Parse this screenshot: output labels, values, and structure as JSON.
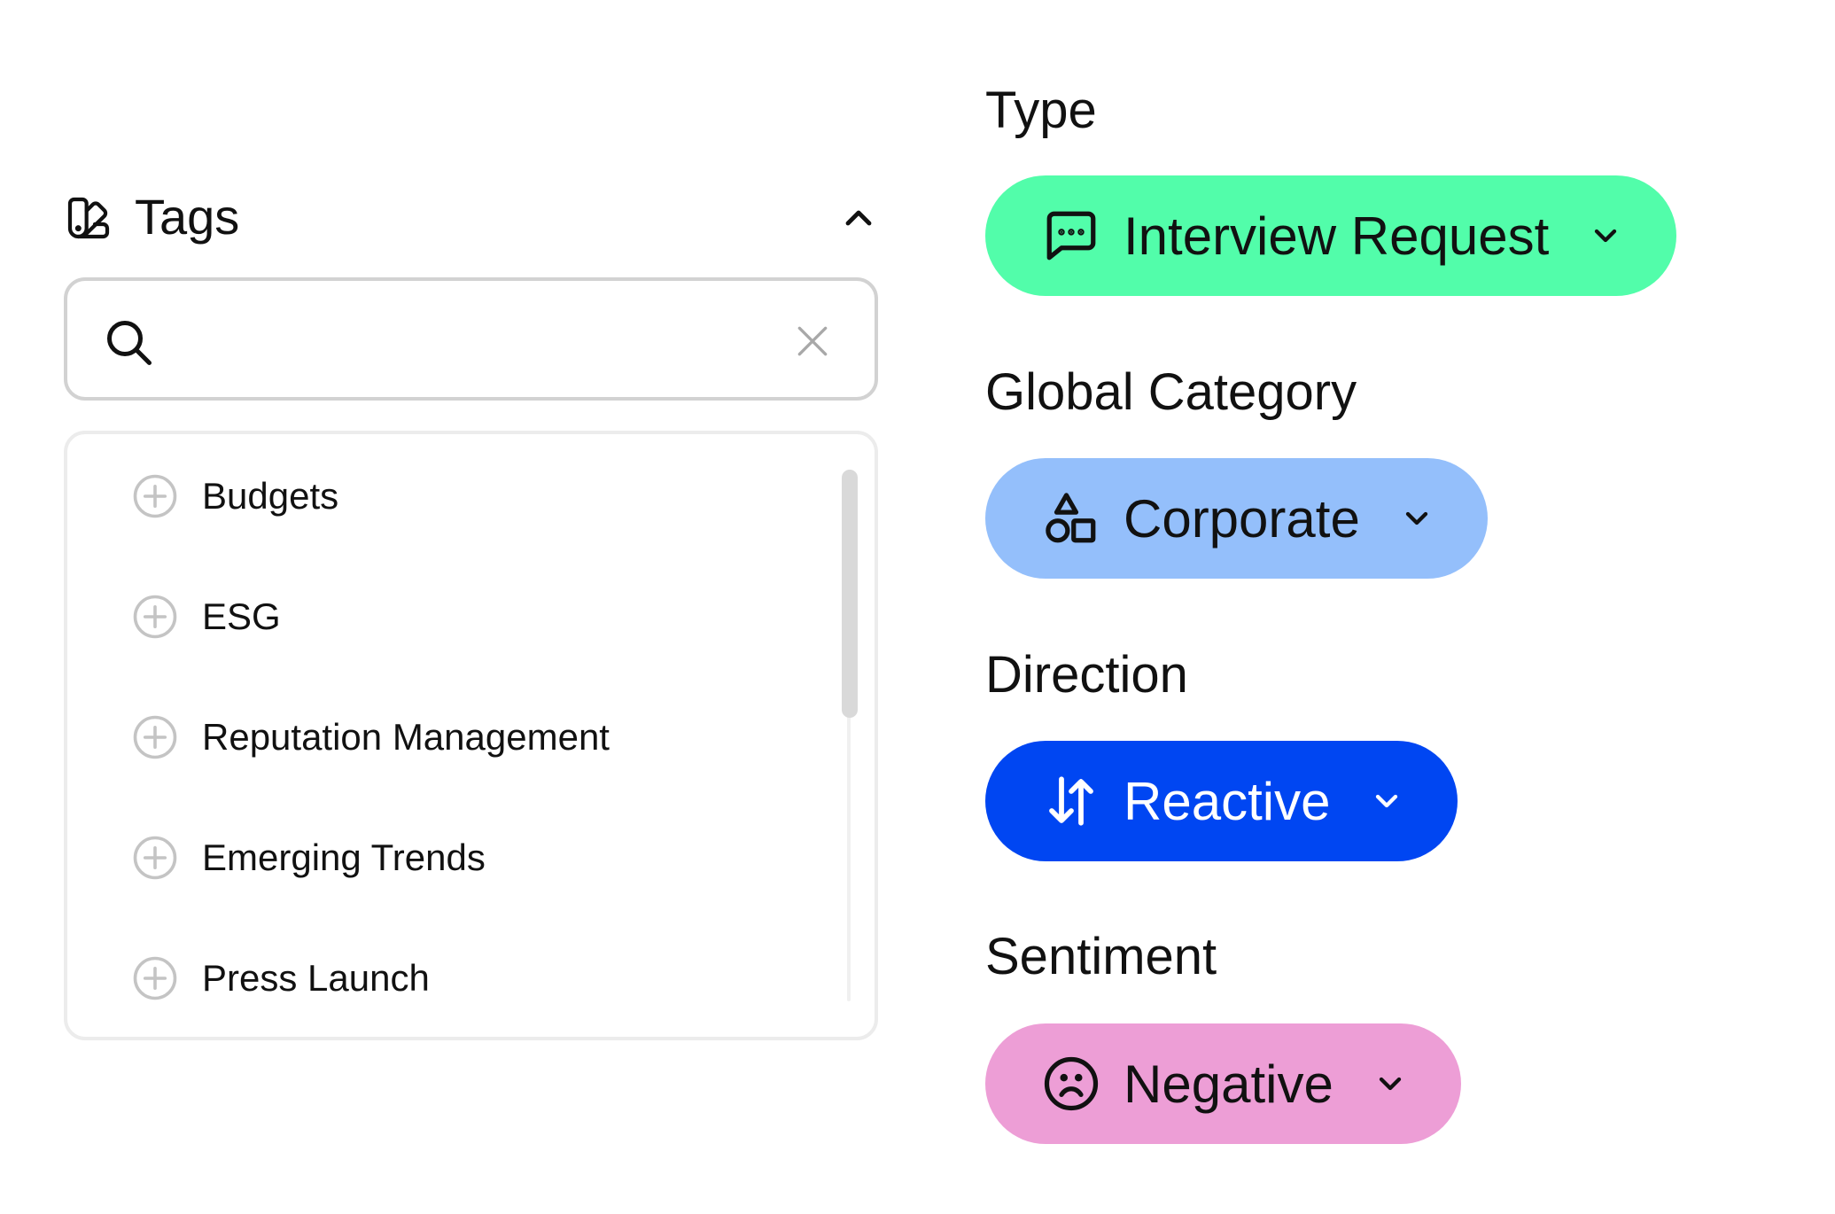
{
  "tags": {
    "title": "Tags",
    "search": {
      "value": "",
      "placeholder": ""
    },
    "items": [
      {
        "label": "Budgets"
      },
      {
        "label": "ESG"
      },
      {
        "label": "Reputation Management"
      },
      {
        "label": "Emerging Trends"
      },
      {
        "label": "Press Launch"
      }
    ]
  },
  "fields": {
    "type": {
      "label": "Type",
      "value": "Interview Request",
      "icon": "chat-bubble-icon",
      "color": "#52fdaa",
      "text_color": "#111111"
    },
    "global_category": {
      "label": "Global Category",
      "value": "Corporate",
      "icon": "shapes-icon",
      "color": "#94bffb",
      "text_color": "#111111"
    },
    "direction": {
      "label": "Direction",
      "value": "Reactive",
      "icon": "arrows-up-down-icon",
      "color": "#0046f2",
      "text_color": "#ffffff"
    },
    "sentiment": {
      "label": "Sentiment",
      "value": "Negative",
      "icon": "sad-face-icon",
      "color": "#ed9ed6",
      "text_color": "#111111"
    }
  }
}
